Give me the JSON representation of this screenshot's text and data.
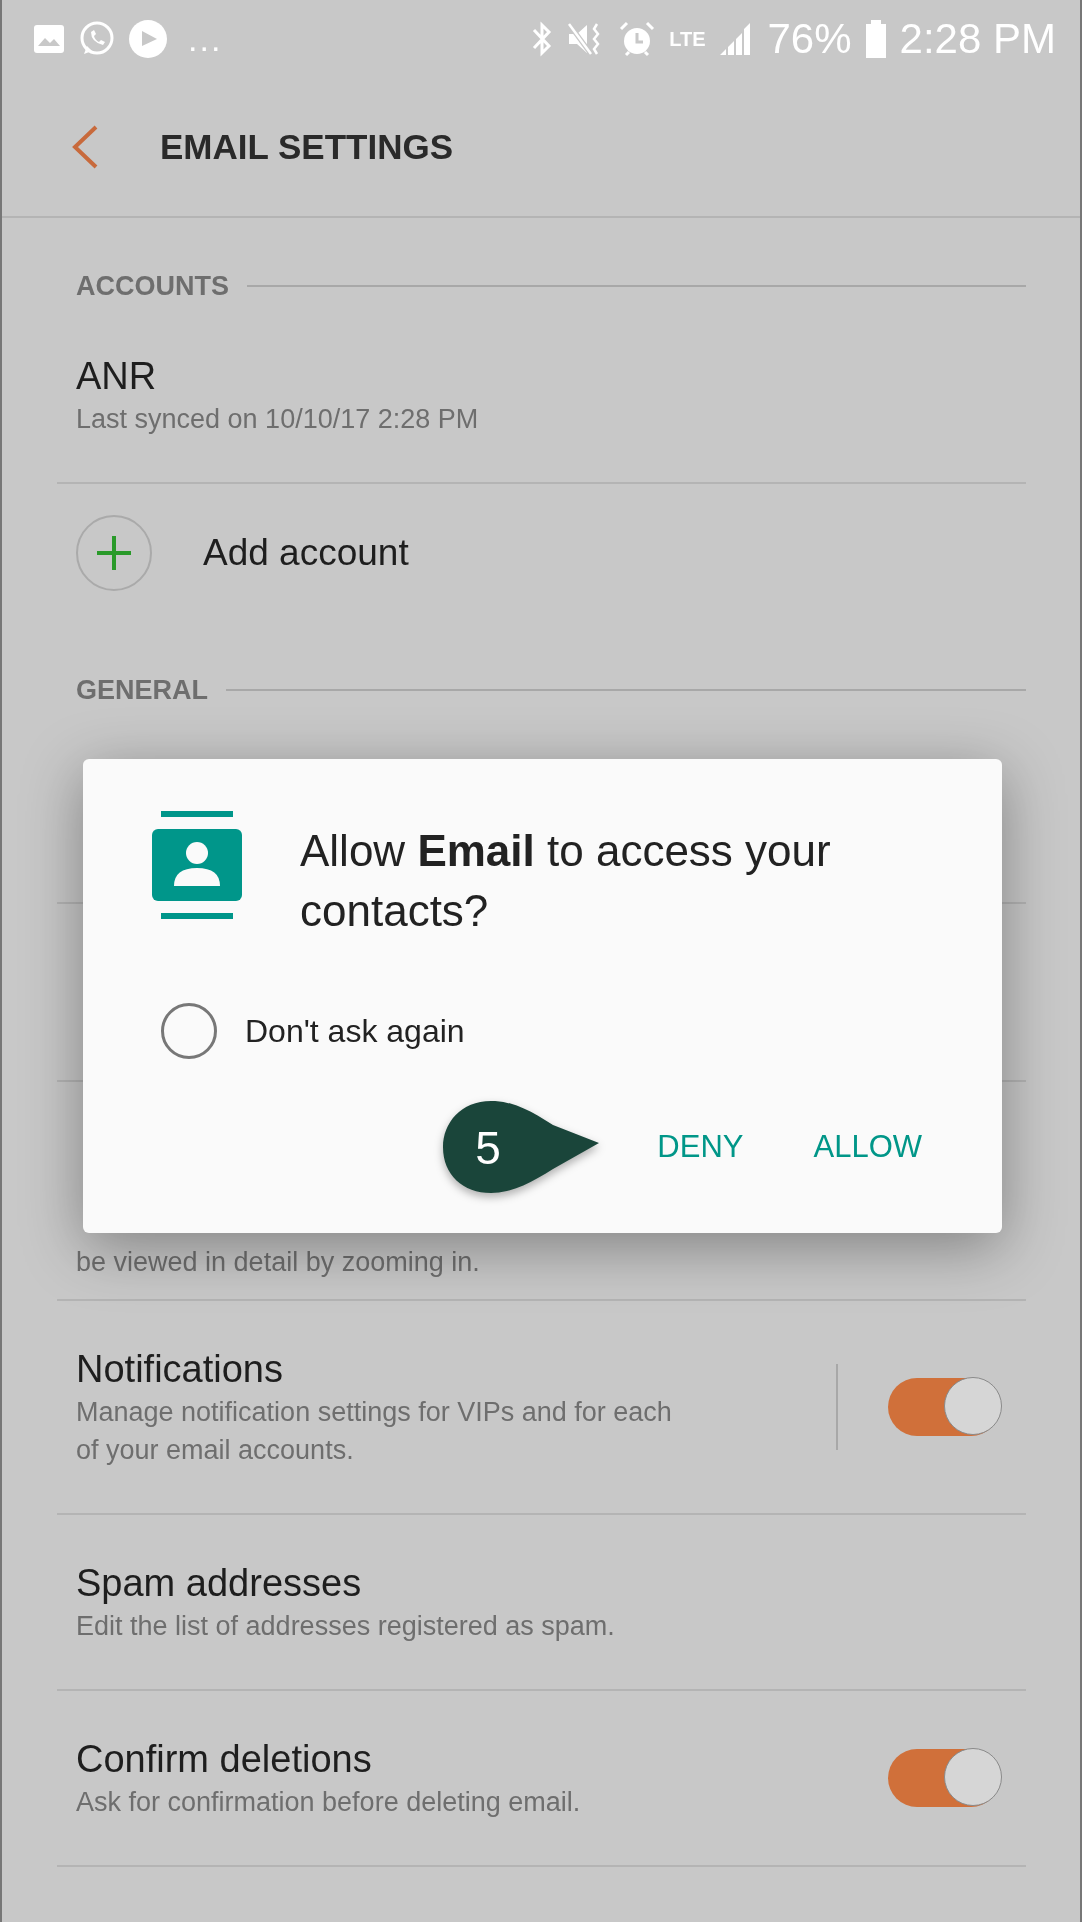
{
  "status_bar": {
    "more": "...",
    "network": "LTE",
    "battery": "76%",
    "time": "2:28 PM"
  },
  "header": {
    "title": "EMAIL SETTINGS"
  },
  "sections": [
    {
      "title": "ACCOUNTS",
      "items": [
        {
          "kind": "account",
          "title": "ANR",
          "subtitle_lines": [
            "Last synced on 10/10/17  2:28 PM"
          ]
        },
        {
          "kind": "add",
          "title": "Add account"
        }
      ]
    },
    {
      "title": "GENERAL",
      "items": [
        {
          "kind": "covered"
        },
        {
          "kind": "covered"
        },
        {
          "kind": "covered",
          "subtitle_lines": [
            "be viewed in detail by zooming in."
          ]
        },
        {
          "kind": "toggle",
          "title": "Notifications",
          "subtitle_lines": [
            "Manage notification settings for VIPs and for each",
            "of your email accounts."
          ],
          "on": true,
          "separator": true
        },
        {
          "kind": "setting",
          "title": "Spam addresses",
          "subtitle_lines": [
            "Edit the list of addresses registered as spam."
          ]
        },
        {
          "kind": "toggle",
          "title": "Confirm deletions",
          "subtitle_lines": [
            "Ask for confirmation before deleting email."
          ],
          "on": true,
          "separator": false
        }
      ]
    }
  ],
  "dialog": {
    "message": "Allow **Email** to access your contacts?",
    "checkbox": {
      "label": "Don't ask again",
      "checked": false
    },
    "buttons": [
      "DENY",
      "ALLOW"
    ]
  },
  "annotation": {
    "label": "5"
  }
}
